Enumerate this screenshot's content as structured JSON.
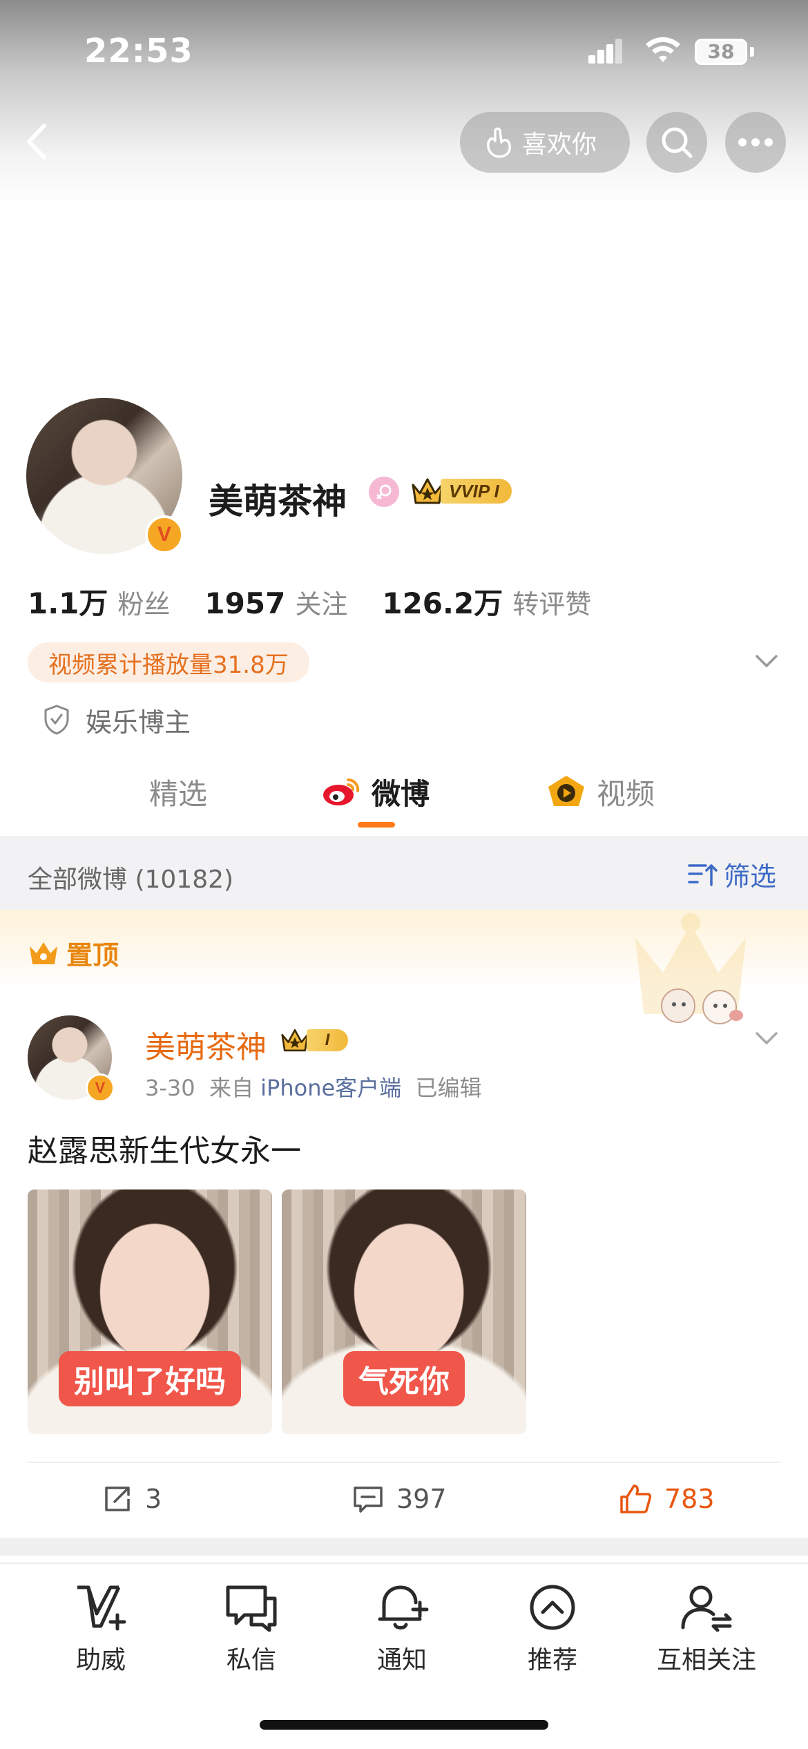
{
  "status_bar": {
    "time": "22:53",
    "battery": "38"
  },
  "header": {
    "like_label": "喜欢你"
  },
  "profile": {
    "name": "美萌茶神",
    "vip_tag": "VVIP I",
    "stats": [
      {
        "value": "1.1万",
        "label": "粉丝"
      },
      {
        "value": "1957",
        "label": "关注"
      },
      {
        "value": "126.2万",
        "label": "转评赞"
      }
    ],
    "play_count": "视频累计播放量31.8万",
    "category": "娱乐博主"
  },
  "tabs": [
    {
      "label": "精选"
    },
    {
      "label": "微博"
    },
    {
      "label": "视频"
    }
  ],
  "feed": {
    "count_label": "全部微博 (10182)",
    "filter_label": "筛选",
    "pinned_label": "置顶"
  },
  "post": {
    "author": "美萌茶神",
    "vip_tag": "I",
    "date": "3-30",
    "source_prefix": "来自",
    "source": "iPhone客户端",
    "edited": "已编辑",
    "text": "赵露思新生代女永一",
    "images": [
      {
        "caption": "别叫了好吗"
      },
      {
        "caption": "气死你"
      }
    ],
    "reposts": "3",
    "comments": "397",
    "likes": "783"
  },
  "bottom_nav": [
    {
      "label": "助威",
      "icon": "v-plus-icon"
    },
    {
      "label": "私信",
      "icon": "message-icon"
    },
    {
      "label": "通知",
      "icon": "bell-icon"
    },
    {
      "label": "推荐",
      "icon": "chevron-up-circle-icon"
    },
    {
      "label": "互相关注",
      "icon": "mutual-follow-icon"
    }
  ],
  "colors": {
    "accent": "#ff7b1a",
    "name_orange": "#e66a12",
    "link_blue": "#3e6ac8",
    "like_red": "#e8560f"
  }
}
